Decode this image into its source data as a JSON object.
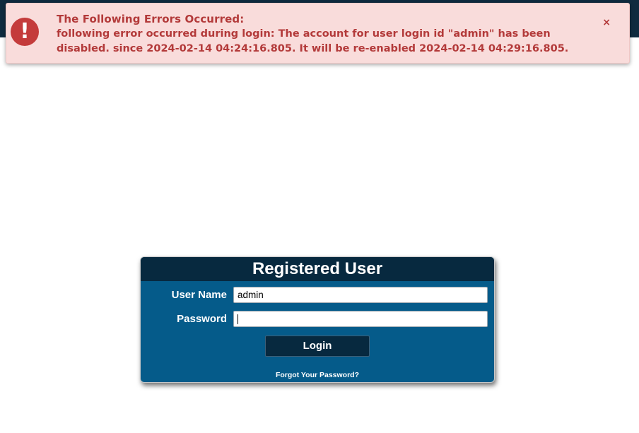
{
  "error": {
    "icon": "exclamation-icon",
    "icon_glyph": "!",
    "title": "The Following Errors Occurred:",
    "message": "following error occurred during login: The account for user login id \"admin\" has been disabled. since 2024-02-14 04:24:16.805. It will be re-enabled 2024-02-14 04:29:16.805.",
    "close_label": "×",
    "colors": {
      "text": "#b33a3a",
      "background": "#f9dcdb",
      "icon": "#c43b3b"
    }
  },
  "login": {
    "title": "Registered User",
    "username_label": "User Name",
    "username_value": "admin",
    "password_label": "Password",
    "password_value": "",
    "login_button": "Login",
    "forgot_link": "Forgot Your Password?",
    "colors": {
      "header": "#07293f",
      "panel": "#055b8a",
      "top_strip": "#0f2b3f"
    }
  }
}
